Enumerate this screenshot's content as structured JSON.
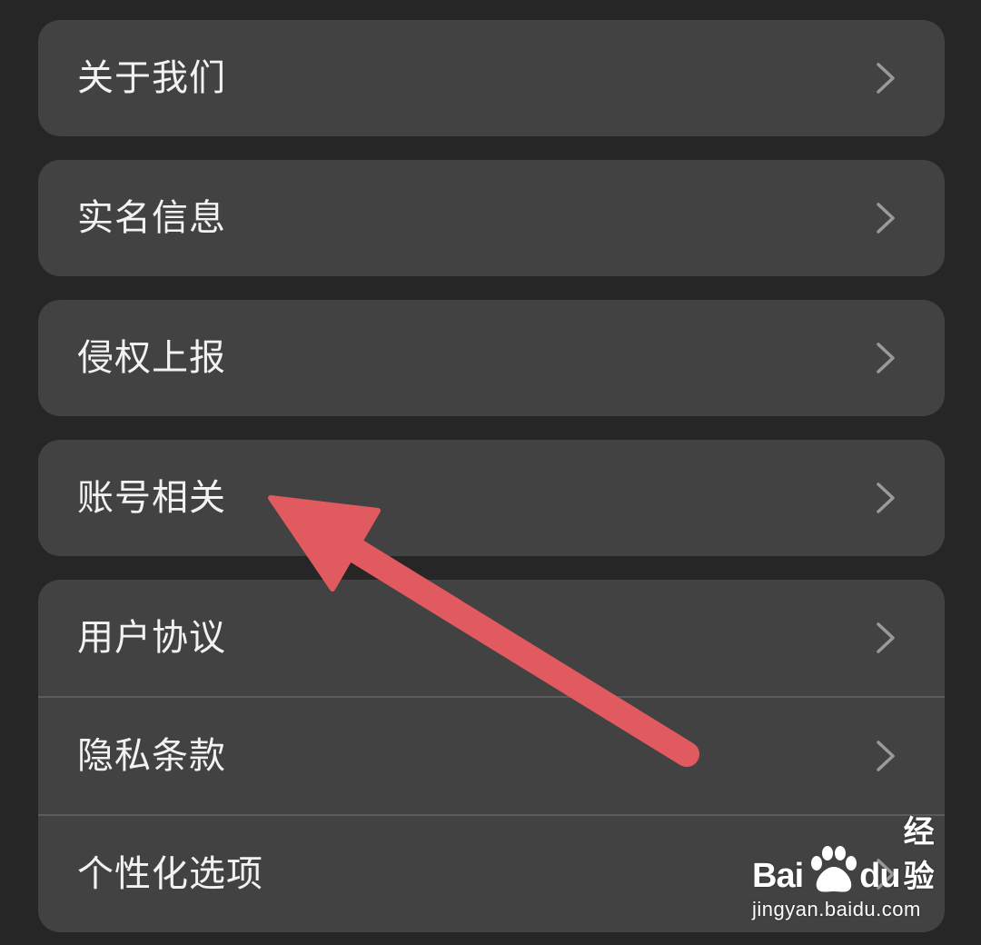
{
  "menu": {
    "items": [
      {
        "label": "关于我们"
      },
      {
        "label": "实名信息"
      },
      {
        "label": "侵权上报"
      },
      {
        "label": "账号相关"
      }
    ],
    "group_items": [
      {
        "label": "用户协议"
      },
      {
        "label": "隐私条款"
      },
      {
        "label": "个性化选项"
      }
    ]
  },
  "annotation": {
    "color": "#e05a5f",
    "points_to": "账号相关"
  },
  "watermark": {
    "brand_left": "Bai",
    "brand_right": "du",
    "brand_cn": "经验",
    "url": "jingyan.baidu.com"
  },
  "colors": {
    "background": "#262626",
    "card": "#424242",
    "text": "#f2f2f2",
    "chevron": "#9a9a9a",
    "separator": "#5c5c5c"
  }
}
